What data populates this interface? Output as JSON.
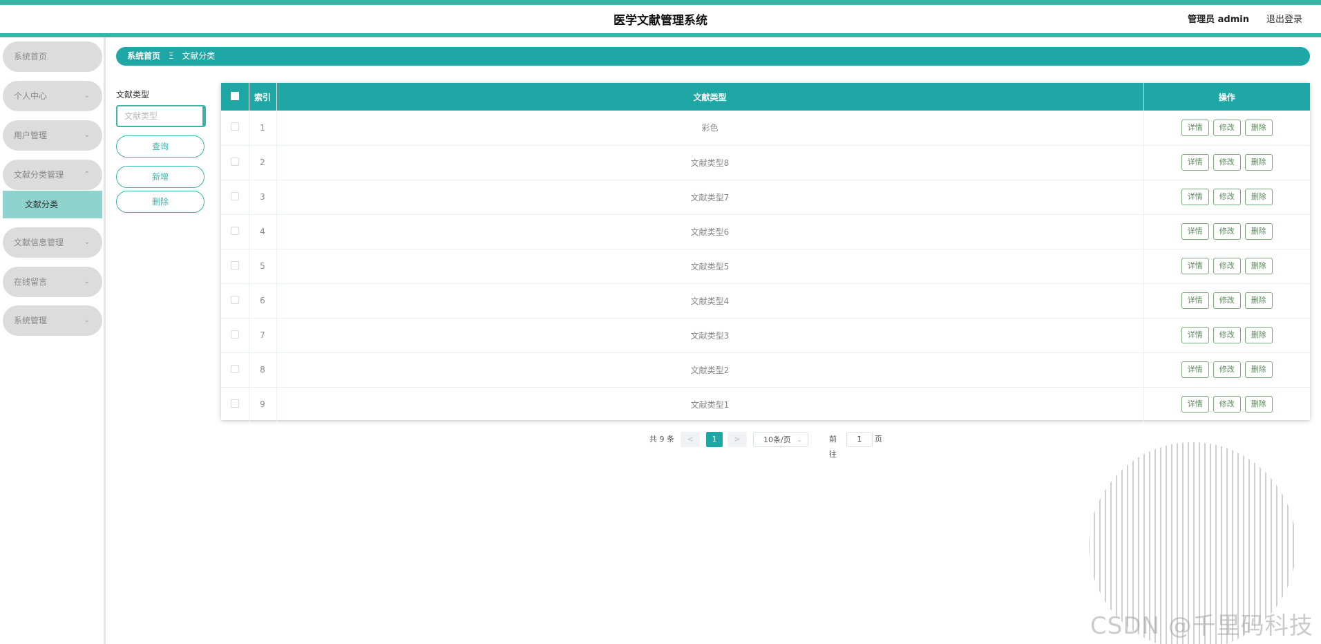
{
  "header": {
    "title": "医学文献管理系统",
    "user": "管理员 admin",
    "logout": "退出登录"
  },
  "sidebar": {
    "items": [
      {
        "label": "系统首页",
        "chevron": ""
      },
      {
        "label": "个人中心",
        "chevron": "chevron-down"
      },
      {
        "label": "用户管理",
        "chevron": "chevron-down"
      },
      {
        "label": "文献分类管理",
        "chevron": "chevron-up"
      },
      {
        "label": "文献信息管理",
        "chevron": "chevron-down"
      },
      {
        "label": "在线留言",
        "chevron": "chevron-down"
      },
      {
        "label": "系统管理",
        "chevron": "chevron-down"
      }
    ],
    "submenu": {
      "label": "文献分类"
    }
  },
  "breadcrumb": {
    "home": "系统首页",
    "separator": "Ξ",
    "current": "文献分类"
  },
  "search": {
    "label": "文献类型",
    "placeholder": "文献类型",
    "query_button": "查询",
    "add_button": "新增",
    "delete_button": "删除"
  },
  "table": {
    "headers": {
      "index": "索引",
      "type": "文献类型",
      "actions": "操作"
    },
    "actions": {
      "detail": "详情",
      "edit": "修改",
      "delete": "删除"
    },
    "rows": [
      {
        "index": "1",
        "type": "彩色"
      },
      {
        "index": "2",
        "type": "文献类型8"
      },
      {
        "index": "3",
        "type": "文献类型7"
      },
      {
        "index": "4",
        "type": "文献类型6"
      },
      {
        "index": "5",
        "type": "文献类型5"
      },
      {
        "index": "6",
        "type": "文献类型4"
      },
      {
        "index": "7",
        "type": "文献类型3"
      },
      {
        "index": "8",
        "type": "文献类型2"
      },
      {
        "index": "9",
        "type": "文献类型1"
      }
    ]
  },
  "pagination": {
    "total": "共 9 条",
    "prev": "<",
    "current_page": "1",
    "next": ">",
    "page_size": "10条/页",
    "goto_label": "前往",
    "goto_value": "1",
    "page_suffix": "页"
  },
  "watermark": "CSDN @千里码科技",
  "colors": {
    "accent": "#1fa7a6",
    "accent_light": "#3bb3ab",
    "submenu_bg": "#8fd3cf",
    "menu_bg": "#dcdcdc"
  }
}
